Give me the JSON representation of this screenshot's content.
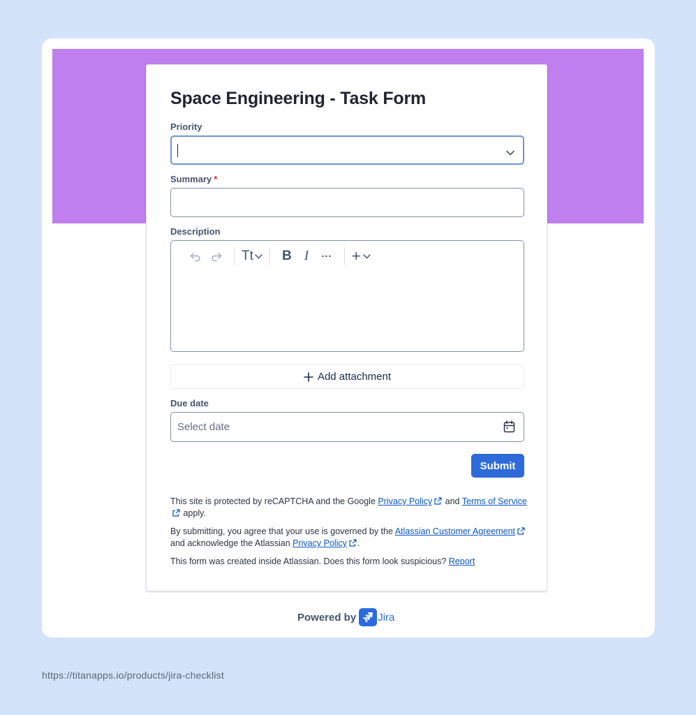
{
  "form": {
    "title": "Space Engineering - Task Form",
    "priority_label": "Priority",
    "summary_label": "Summary",
    "required_mark": "*",
    "description_label": "Description",
    "add_attachment_label": "Add attachment",
    "due_date_label": "Due date",
    "due_date_placeholder": "Select date",
    "submit_label": "Submit"
  },
  "toolbar": {
    "text_style_label": "Tt",
    "bold_label": "B",
    "italic_label": "I",
    "more_label": "···",
    "insert_label": "+"
  },
  "legal": {
    "recaptcha_prefix": "This site is protected by reCAPTCHA and the Google ",
    "recaptcha_privacy_link": "Privacy Policy",
    "recaptcha_and": " and ",
    "recaptcha_terms_link": "Terms of Service",
    "recaptcha_suffix": " apply.",
    "agreement_prefix": "By submitting, you agree that your use is governed by the ",
    "agreement_link": "Atlassian Customer Agreement",
    "agreement_middle": " and acknowledge the Atlassian ",
    "agreement_privacy_link": "Privacy Policy",
    "agreement_suffix": ".",
    "suspicious_text": "This form was created inside Atlassian. Does this form look suspicious? ",
    "report_link": "Report"
  },
  "footer": {
    "powered_by": "Powered by",
    "product_name": "Jira",
    "source_url": "https://titanapps.io/products/jira-checklist"
  },
  "colors": {
    "page_background": "#d3e3f9",
    "banner": "#bf7fee",
    "primary_button": "#2f6bd8",
    "link": "#0c56c6",
    "required": "#c9372c"
  }
}
